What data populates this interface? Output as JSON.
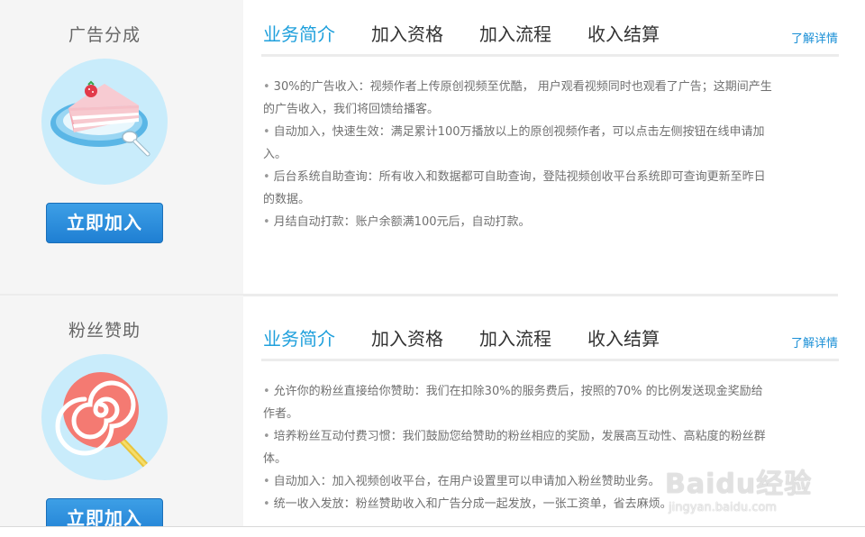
{
  "sections": [
    {
      "title": "广告分成",
      "join_label": "立即加入",
      "icon": "cake-slice-icon",
      "tabs": [
        {
          "label": "业务简介"
        },
        {
          "label": "加入资格"
        },
        {
          "label": "加入流程"
        },
        {
          "label": "收入结算"
        }
      ],
      "details_link": "了解详情",
      "items": [
        "30%的广告收入：视频作者上传原创视频至优酷， 用户观看视频同时也观看了广告；这期间产生的广告收入，我们将回馈给播客。",
        "自动加入，快速生效：满足累计100万播放以上的原创视频作者，可以点击左侧按钮在线申请加入。",
        "后台系统自助查询：所有收入和数据都可自助查询，登陆视频创收平台系统即可查询更新至昨日的数据。",
        "月结自动打款：账户余额满100元后，自动打款。"
      ]
    },
    {
      "title": "粉丝赞助",
      "join_label": "立即加入",
      "icon": "lollipop-icon",
      "tabs": [
        {
          "label": "业务简介"
        },
        {
          "label": "加入资格"
        },
        {
          "label": "加入流程"
        },
        {
          "label": "收入结算"
        }
      ],
      "details_link": "了解详情",
      "items": [
        "允许你的粉丝直接给你赞助：我们在扣除30%的服务费后，按照的70% 的比例发送现金奖励给作者。",
        "培养粉丝互动付费习惯：我们鼓励您给赞助的粉丝相应的奖励，发展高互动性、高粘度的粉丝群体。",
        "自动加入：加入视频创收平台，在用户设置里可以申请加入粉丝赞助业务。",
        "统一收入发放：粉丝赞助收入和广告分成一起发放，一张工资单，省去麻烦。"
      ]
    }
  ],
  "bullet_char": "•",
  "watermark": {
    "logo": "Baidu经验",
    "sub": "jingyan.baidu.com"
  },
  "colors": {
    "accent": "#1fa0dc",
    "button": "#1f7fd3",
    "link": "#1a8fd6",
    "panel": "#f5f5f5",
    "icon_bg": "#c9ecfb"
  }
}
